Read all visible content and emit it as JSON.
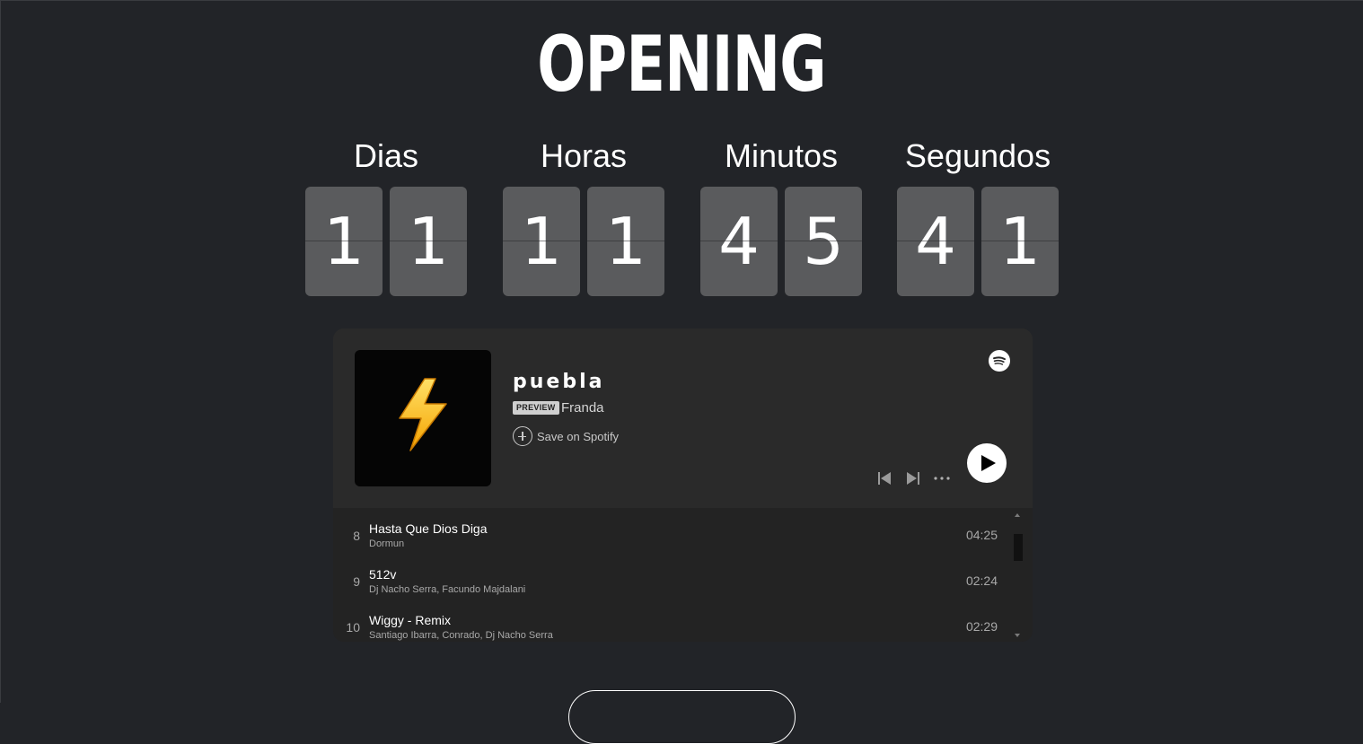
{
  "headline": "OPENING",
  "countdown": {
    "units": [
      {
        "label": "Dias",
        "digits": [
          "1",
          "1"
        ]
      },
      {
        "label": "Horas",
        "digits": [
          "1",
          "1"
        ]
      },
      {
        "label": "Minutos",
        "digits": [
          "4",
          "5"
        ]
      },
      {
        "label": "Segundos",
        "digits": [
          "4",
          "1"
        ]
      }
    ]
  },
  "player": {
    "title": "puebla",
    "preview_badge": "PREVIEW",
    "artist": "Franda",
    "save_label": "Save on Spotify",
    "cover_icon": "lightning-bolt",
    "logo_icon": "spotify-logo",
    "tracks": [
      {
        "number": "8",
        "title": "Hasta Que Dios Diga",
        "artist": "Dormun",
        "duration": "04:25"
      },
      {
        "number": "9",
        "title": "512v",
        "artist": "Dj Nacho Serra, Facundo Majdalani",
        "duration": "02:24"
      },
      {
        "number": "10",
        "title": "Wiggy - Remix",
        "artist": "Santiago Ibarra, Conrado, Dj Nacho Serra",
        "duration": "02:29"
      }
    ]
  },
  "colors": {
    "background": "#222428",
    "digit_tile": "#5a5b5d",
    "player_bg": "#282828"
  }
}
